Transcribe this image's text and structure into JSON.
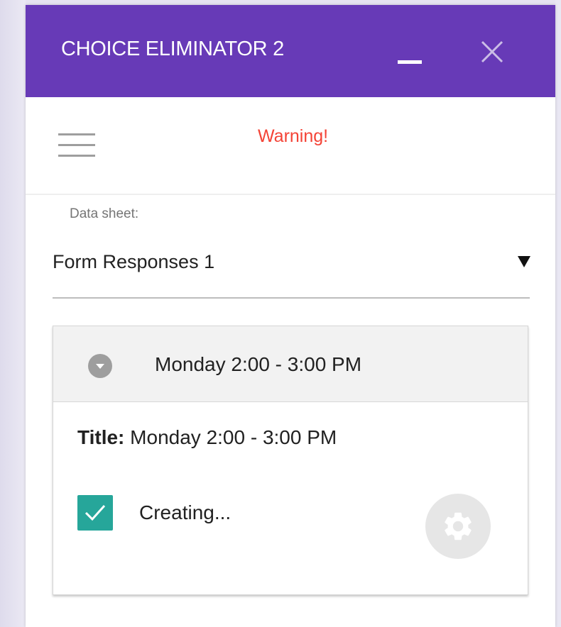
{
  "app": {
    "title": "CHOICE ELIMINATOR 2",
    "accent_color": "#673ab7"
  },
  "window_controls": {
    "minimize_icon": "minimize-icon",
    "close_icon": "close-icon"
  },
  "toolbar": {
    "menu_icon": "hamburger-menu-icon",
    "warning": "Warning!",
    "warning_color": "#f44336"
  },
  "data_sheet": {
    "label": "Data sheet:",
    "selected": "Form Responses 1",
    "dropdown_icon": "triangle-down-icon"
  },
  "question_card": {
    "header_title": "Monday 2:00 - 3:00 PM",
    "expand_icon": "chevron-down-circle-icon",
    "title_label": "Title:",
    "title_value": "Monday 2:00 - 3:00 PM",
    "checkbox_checked": true,
    "checkbox_color": "#26a69a",
    "status": "Creating...",
    "settings_icon": "gear-icon"
  }
}
